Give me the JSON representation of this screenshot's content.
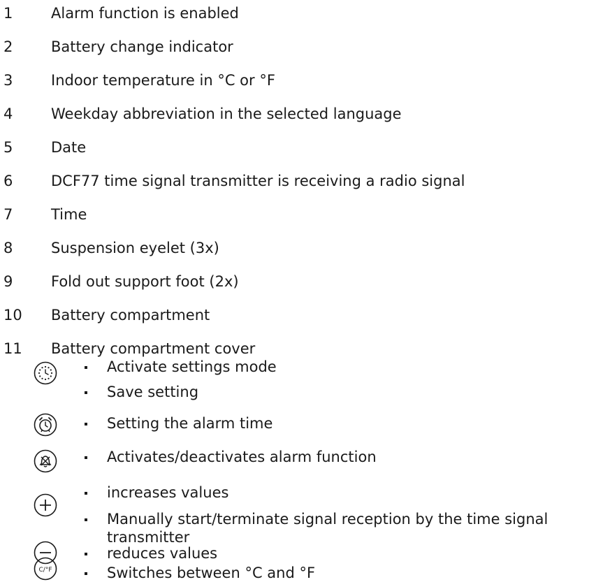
{
  "items": [
    {
      "num": "1",
      "label": "Alarm function is enabled"
    },
    {
      "num": "2",
      "label": "Battery change indicator"
    },
    {
      "num": "3",
      "label": "Indoor temperature in °C or °F"
    },
    {
      "num": "4",
      "label": "Weekday abbreviation in the selected language"
    },
    {
      "num": "5",
      "label": "Date"
    },
    {
      "num": "6",
      "label": "DCF77 time signal transmitter is receiving a radio signal"
    },
    {
      "num": "7",
      "label": "Time"
    },
    {
      "num": "8",
      "label": "Suspension eyelet (3x)"
    },
    {
      "num": "9",
      "label": "Fold out support foot (2x)"
    },
    {
      "num": "10",
      "label": "Battery compartment"
    },
    {
      "num": "11",
      "label": "Battery compartment cover"
    }
  ],
  "buttons": [
    {
      "icon": "settings-clock-icon",
      "bullets": [
        "Activate settings mode",
        "Save setting"
      ]
    },
    {
      "icon": "alarm-clock-icon",
      "bullets": [
        "Setting the alarm time"
      ]
    },
    {
      "icon": "alarm-off-icon",
      "bullets": [
        "Activates/deactivates alarm function"
      ]
    },
    {
      "icon": "plus-icon",
      "bullets": [
        "increases values",
        "Manually start/terminate signal reception by the time signal",
        "transmitter"
      ]
    },
    {
      "icon": "minus-icon",
      "bullets": [
        "reduces values"
      ]
    },
    {
      "icon": "celsius-fahrenheit-icon",
      "icon_text": "C/°F",
      "bullets": [
        "Switches between °C and °F"
      ]
    }
  ]
}
